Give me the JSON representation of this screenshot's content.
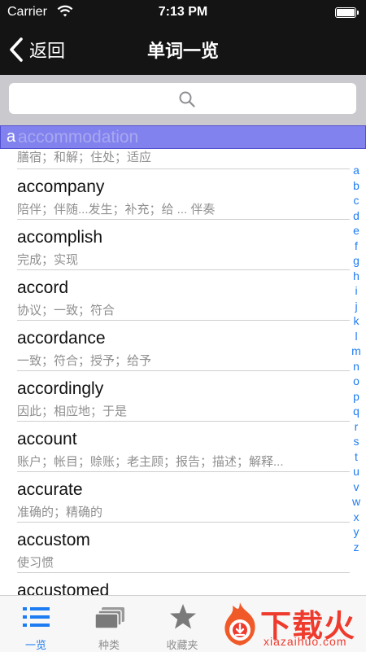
{
  "status_bar": {
    "carrier": "Carrier",
    "time": "7:13 PM"
  },
  "nav": {
    "back_label": "返回",
    "title": "单词一览"
  },
  "search": {
    "placeholder": ""
  },
  "section_header": {
    "letter": "a",
    "word": "accommodation"
  },
  "words": [
    {
      "en": "",
      "cn": "膳宿；和解；住处；适应"
    },
    {
      "en": "accompany",
      "cn": "陪伴；伴随...发生；补充；给 ... 伴奏"
    },
    {
      "en": "accomplish",
      "cn": "完成；实现"
    },
    {
      "en": "accord",
      "cn": "协议；一致；符合"
    },
    {
      "en": "accordance",
      "cn": "一致；符合；授予；给予"
    },
    {
      "en": "accordingly",
      "cn": "因此；相应地；于是"
    },
    {
      "en": "account",
      "cn": "账户；帐目；赊账；老主顾；报告；描述；解释..."
    },
    {
      "en": "accurate",
      "cn": "准确的；精确的"
    },
    {
      "en": "accustom",
      "cn": "使习惯"
    },
    {
      "en": "accustomed",
      "cn": ""
    }
  ],
  "alphabet": [
    "a",
    "b",
    "c",
    "d",
    "e",
    "f",
    "g",
    "h",
    "i",
    "j",
    "k",
    "l",
    "m",
    "n",
    "o",
    "p",
    "q",
    "r",
    "s",
    "t",
    "u",
    "v",
    "w",
    "x",
    "y",
    "z"
  ],
  "tabs": [
    {
      "label": "一览",
      "icon": "list-icon",
      "active": true
    },
    {
      "label": "种类",
      "icon": "cards-icon",
      "active": false
    },
    {
      "label": "收藏夹",
      "icon": "star-icon",
      "active": false
    }
  ],
  "watermark": {
    "text": "下载火",
    "sub": "xiazaihuo.com"
  },
  "colors": {
    "accent": "#1e7cf2",
    "nav_bg": "#141414",
    "highlight": "#6666ec",
    "watermark": "#ef3b2d"
  }
}
